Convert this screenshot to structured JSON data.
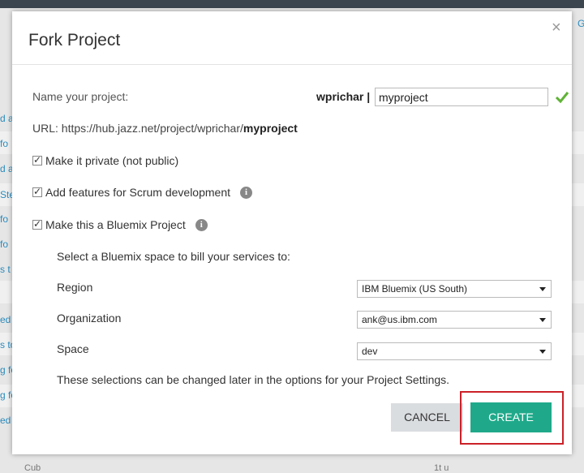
{
  "background": {
    "links": [
      "d a",
      "fo",
      "d a",
      "Ste",
      "fo",
      "fo",
      "s t",
      "ed",
      "s to",
      "g fo",
      "g fo",
      "ed"
    ],
    "right_link": "G",
    "bottom_left": "Cub",
    "bottom_right": "1t u"
  },
  "dialog": {
    "title": "Fork Project",
    "close_glyph": "×",
    "name_label": "Name your project:",
    "owner": "wprichar |",
    "project_name_value": "myproject",
    "url_prefix": "URL:  https://hub.jazz.net/project/wprichar/",
    "url_slug": "myproject",
    "checkboxes": [
      {
        "label": "Make it private (not public)",
        "checked": true,
        "info": false
      },
      {
        "label": "Add features for Scrum development",
        "checked": true,
        "info": true
      },
      {
        "label": "Make this a Bluemix Project",
        "checked": true,
        "info": true
      }
    ],
    "bluemix_intro": "Select a Bluemix space to bill your services to:",
    "region_label": "Region",
    "region_value": "IBM Bluemix (US South)",
    "org_label": "Organization",
    "org_value": "ank@us.ibm.com",
    "space_label": "Space",
    "space_value": "dev",
    "note": "These selections can be changed later in the options for your Project Settings.",
    "cancel_label": "CANCEL",
    "create_label": "CREATE"
  },
  "colors": {
    "accent": "#1fa98a",
    "highlight": "#cc2128",
    "link": "#2a8bbd",
    "check": "#5fb336"
  },
  "icons": {
    "close": "close-icon",
    "valid": "checkmark-icon",
    "info": "info-icon",
    "dropdown": "chevron-down-icon"
  }
}
